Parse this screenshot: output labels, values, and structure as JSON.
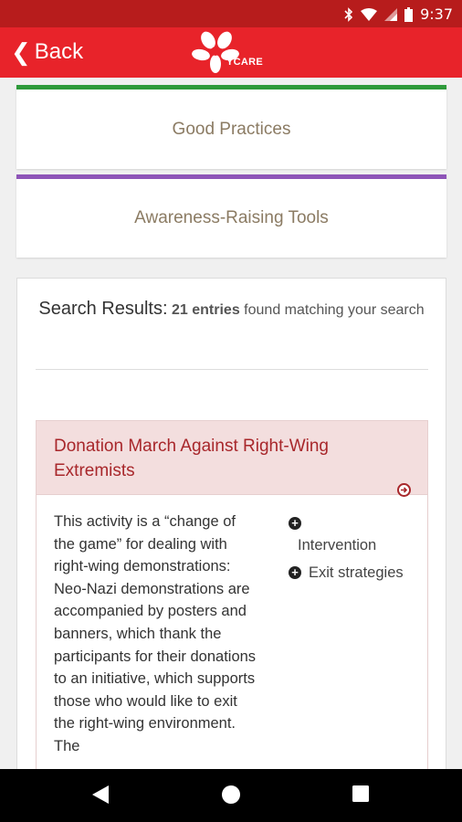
{
  "status_bar": {
    "time": "9:37",
    "icons": [
      "bluetooth-icon",
      "wifi-icon",
      "signal-icon",
      "battery-icon"
    ]
  },
  "app_bar": {
    "back_label": "Back",
    "logo_text": "YCARE"
  },
  "tiles": [
    {
      "label": "Good Practices",
      "accent": "#2e9a3a"
    },
    {
      "label": "Awareness-Raising Tools",
      "accent": "#8e55b8"
    }
  ],
  "results": {
    "label": "Search Results:",
    "count": "21 entries",
    "suffix": "found matching your search"
  },
  "entries": [
    {
      "title": "Donation March Against Right-Wing Extremists",
      "description": "This activity is a “change of the game” for dealing with right-wing demonstrations: Neo-Nazi demonstrations are accompanied by posters and banners, which thank the participants for their donations to an initiative, which supports those who would like to exit the right-wing environment. The",
      "tags": [
        "Intervention",
        "Exit strategies"
      ]
    }
  ],
  "colors": {
    "status_bar": "#b71c1c",
    "app_bar": "#e8232a",
    "entry_title": "#a8272b",
    "entry_header_bg": "#f3dede"
  }
}
